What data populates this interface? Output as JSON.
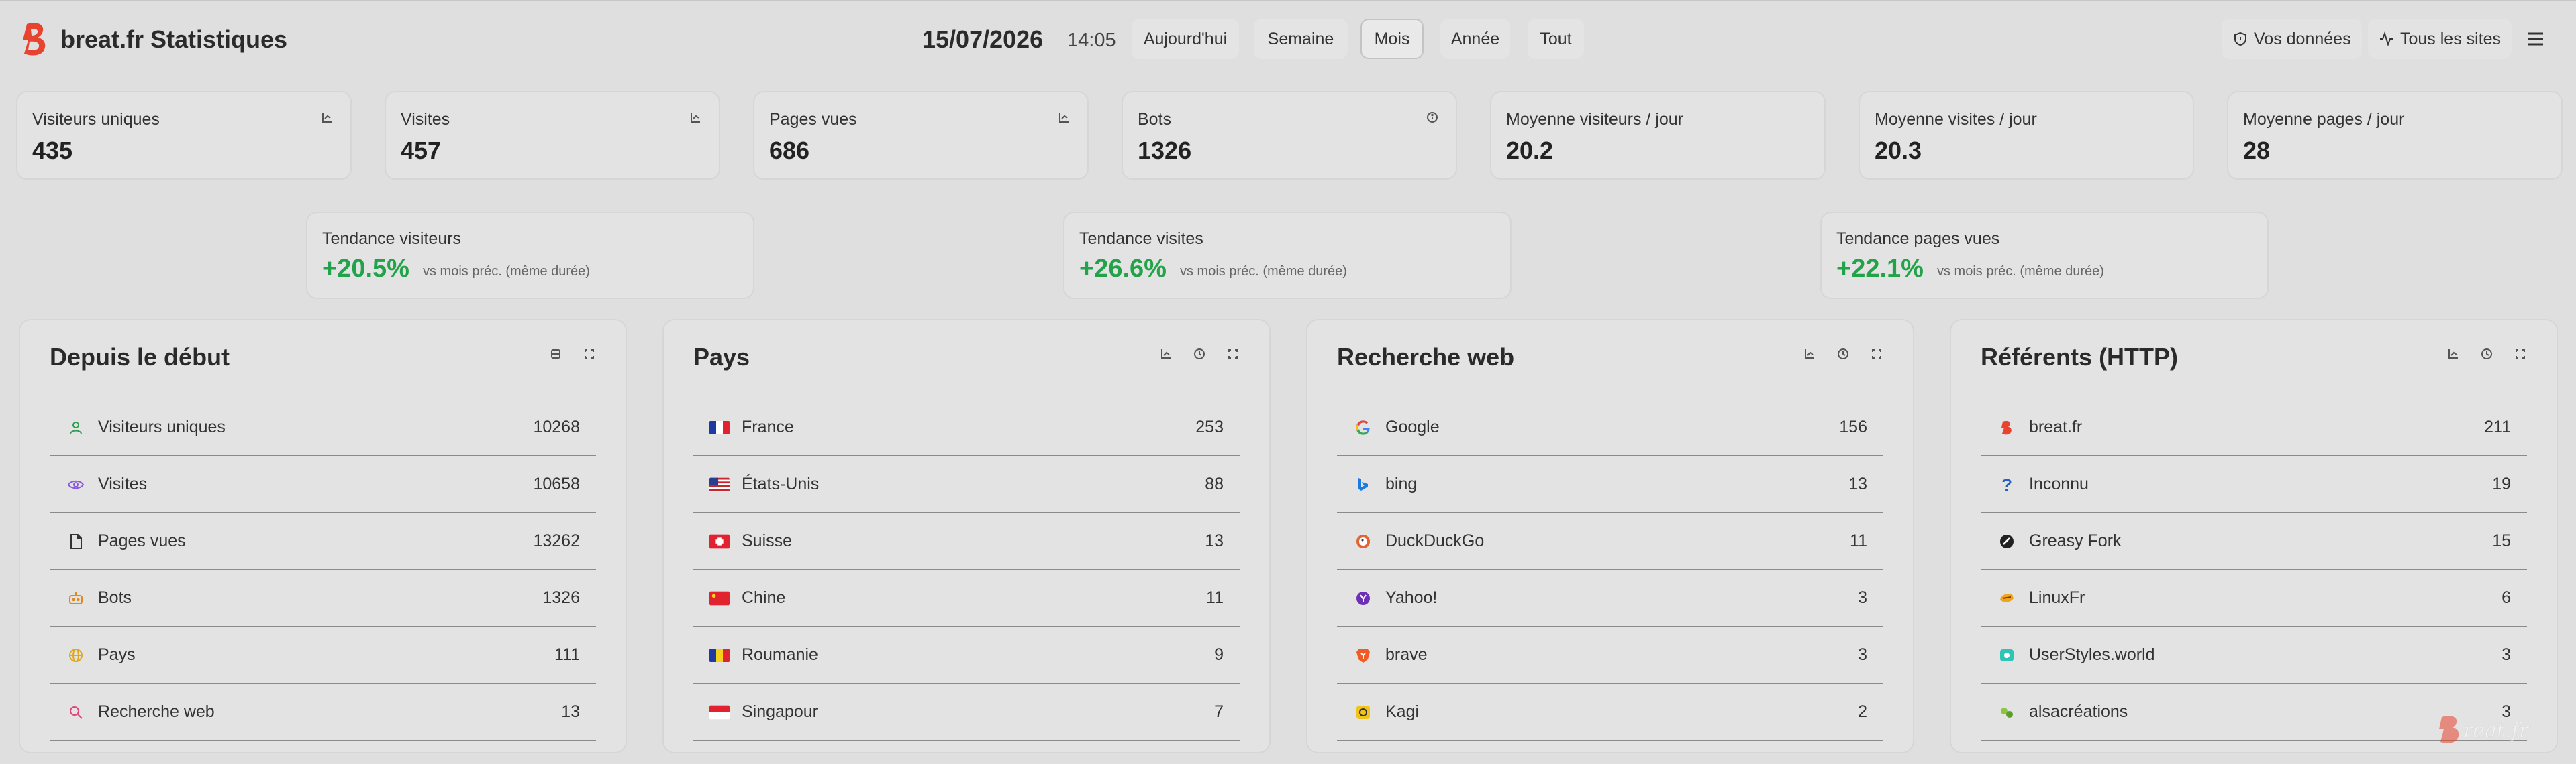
{
  "header": {
    "site_title": "breat.fr Statistiques",
    "date": "15/07/2026",
    "time": "14:05",
    "periods": [
      "Aujourd'hui",
      "Semaine",
      "Mois",
      "Année",
      "Tout"
    ],
    "active_period": "Mois",
    "your_data_label": "Vos données",
    "all_sites_label": "Tous les sites",
    "brand_color": "#e8432e"
  },
  "stats": [
    {
      "label": "Visiteurs uniques",
      "value": "435",
      "icon": "chart-icon"
    },
    {
      "label": "Visites",
      "value": "457",
      "icon": "chart-icon"
    },
    {
      "label": "Pages vues",
      "value": "686",
      "icon": "chart-icon"
    },
    {
      "label": "Bots",
      "value": "1326",
      "icon": "info-icon"
    },
    {
      "label": "Moyenne visiteurs / jour",
      "value": "20.2"
    },
    {
      "label": "Moyenne visites / jour",
      "value": "20.3"
    },
    {
      "label": "Moyenne pages / jour",
      "value": "28"
    }
  ],
  "trends": [
    {
      "label": "Tendance visiteurs",
      "value": "+20.5%",
      "note": "vs mois préc. (même durée)"
    },
    {
      "label": "Tendance visites",
      "value": "+26.6%",
      "note": "vs mois préc. (même durée)"
    },
    {
      "label": "Tendance pages vues",
      "value": "+22.1%",
      "note": "vs mois préc. (même durée)"
    }
  ],
  "trend_color": "#22a34a",
  "panels": {
    "since_start": {
      "title": "Depuis le début",
      "rows": [
        {
          "label": "Visiteurs uniques",
          "value": "10268",
          "icon": "user-icon"
        },
        {
          "label": "Visites",
          "value": "10658",
          "icon": "eye-icon"
        },
        {
          "label": "Pages vues",
          "value": "13262",
          "icon": "file-icon"
        },
        {
          "label": "Bots",
          "value": "1326",
          "icon": "bot-icon"
        },
        {
          "label": "Pays",
          "value": "111",
          "icon": "globe-icon"
        },
        {
          "label": "Recherche web",
          "value": "13",
          "icon": "search-icon"
        }
      ]
    },
    "countries": {
      "title": "Pays",
      "rows": [
        {
          "label": "France",
          "value": "253",
          "icon": "flag-france-icon"
        },
        {
          "label": "États-Unis",
          "value": "88",
          "icon": "flag-usa-icon"
        },
        {
          "label": "Suisse",
          "value": "13",
          "icon": "flag-switzerland-icon"
        },
        {
          "label": "Chine",
          "value": "11",
          "icon": "flag-china-icon"
        },
        {
          "label": "Roumanie",
          "value": "9",
          "icon": "flag-romania-icon"
        },
        {
          "label": "Singapour",
          "value": "7",
          "icon": "flag-singapore-icon"
        }
      ]
    },
    "web_search": {
      "title": "Recherche web",
      "rows": [
        {
          "label": "Google",
          "value": "156",
          "icon": "google-icon"
        },
        {
          "label": "bing",
          "value": "13",
          "icon": "bing-icon"
        },
        {
          "label": "DuckDuckGo",
          "value": "11",
          "icon": "duckduckgo-icon"
        },
        {
          "label": "Yahoo!",
          "value": "3",
          "icon": "yahoo-icon"
        },
        {
          "label": "brave",
          "value": "3",
          "icon": "brave-icon"
        },
        {
          "label": "Kagi",
          "value": "2",
          "icon": "kagi-icon"
        }
      ]
    },
    "referrers": {
      "title": "Référents (HTTP)",
      "rows": [
        {
          "label": "breat.fr",
          "value": "211",
          "icon": "breat-logo-icon"
        },
        {
          "label": "Inconnu",
          "value": "19",
          "icon": "question-icon"
        },
        {
          "label": "Greasy Fork",
          "value": "15",
          "icon": "greasyfork-icon"
        },
        {
          "label": "LinuxFr",
          "value": "6",
          "icon": "linuxfr-icon"
        },
        {
          "label": "UserStyles.world",
          "value": "3",
          "icon": "userstyles-icon"
        },
        {
          "label": "alsacréations",
          "value": "3",
          "icon": "alsacreations-icon"
        }
      ]
    }
  },
  "watermark": "Breat.fr"
}
